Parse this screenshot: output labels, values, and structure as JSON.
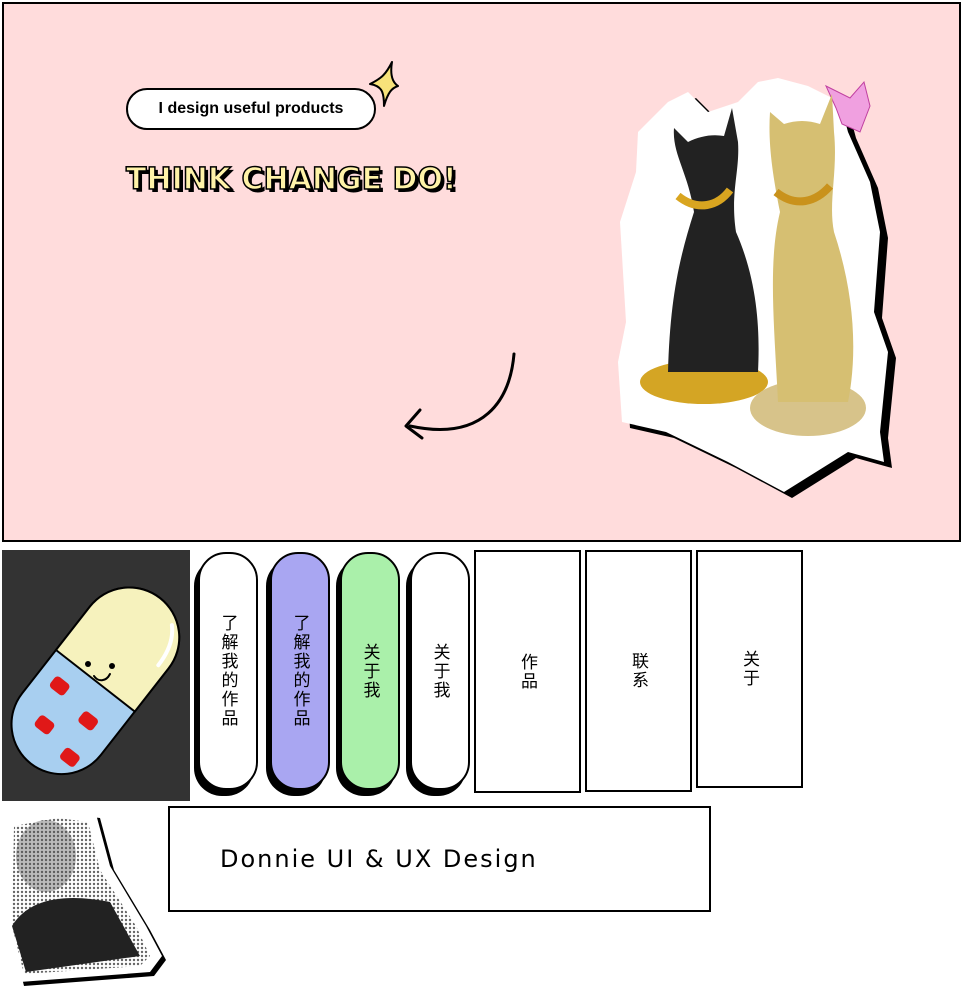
{
  "hero": {
    "tagline": "I design useful products",
    "headline": "THINK CHANGE DO!"
  },
  "colors": {
    "hero_bg": "#ffdcdc",
    "pill_purple": "#a9a6f2",
    "pill_green": "#aaf0aa",
    "headline_fill": "#fff3a8",
    "tile_dark": "#333333"
  },
  "nav": {
    "pill_1": "了解我的作品",
    "pill_2": "了解我的作品",
    "pill_3": "关于我",
    "pill_4": "关于我",
    "box_1": "作品",
    "box_2": "联系",
    "box_3": "关于"
  },
  "brand": {
    "name": "Donnie UI & UX Design"
  }
}
